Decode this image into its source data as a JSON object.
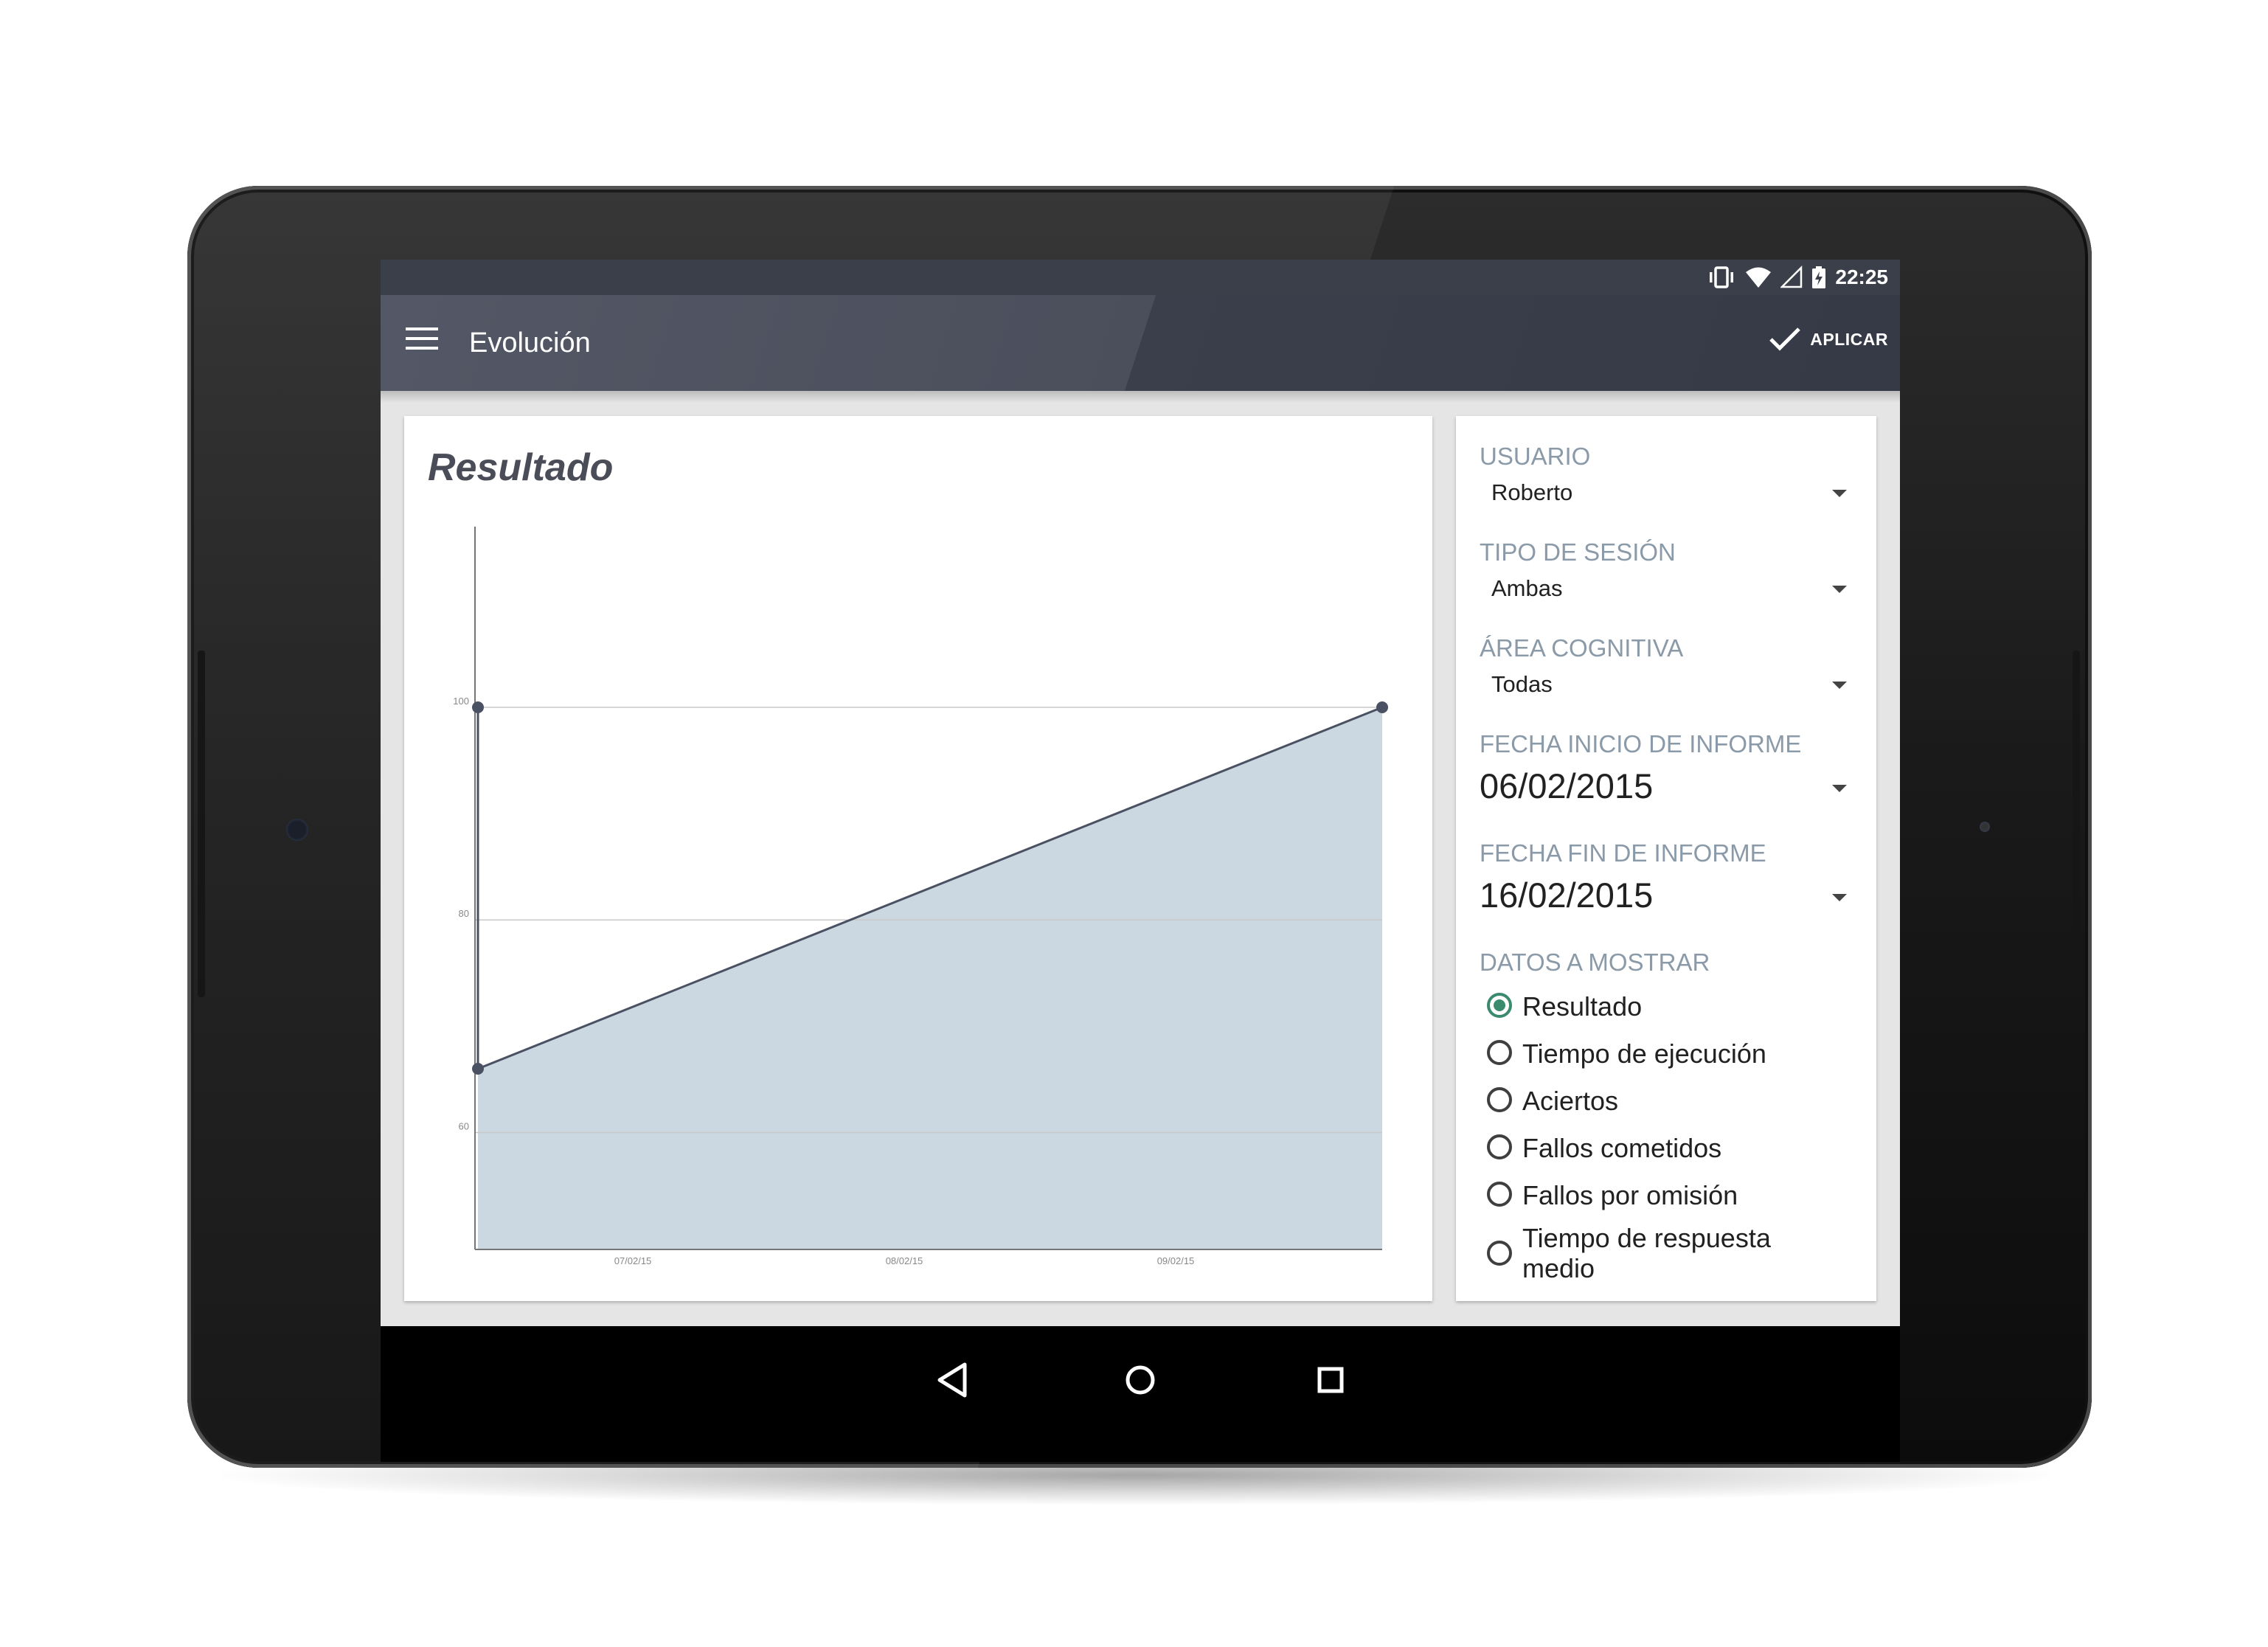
{
  "status_bar": {
    "time": "22:25",
    "icons": [
      "vibrate-icon",
      "wifi-icon",
      "cell-signal-icon",
      "battery-charging-icon"
    ]
  },
  "app_bar": {
    "title": "Evolución",
    "menu_icon": "hamburger-menu-icon",
    "apply_icon": "check-icon",
    "apply_label": "APLICAR"
  },
  "chart": {
    "title": "Resultado"
  },
  "chart_data": {
    "type": "area",
    "title": "Resultado",
    "xlabel": "",
    "ylabel": "",
    "x_tick_labels": [
      "07/02/15",
      "08/02/15",
      "09/02/15"
    ],
    "y_tick_labels": [
      "60",
      "80",
      "100"
    ],
    "ylim": [
      49,
      117
    ],
    "grid": true,
    "series": [
      {
        "x": [
          "06/02/15",
          "06/02/15",
          "09/02/15 +"
        ],
        "values": [
          100,
          66,
          100
        ]
      }
    ],
    "colors": {
      "line": "#4a5162",
      "fill": "#cbd8e1",
      "grid": "#c8c8c8",
      "axis": "#757575"
    }
  },
  "filters": {
    "usuario": {
      "label": "USUARIO",
      "value": "Roberto"
    },
    "tipo_sesion": {
      "label": "TIPO DE SESIÓN",
      "value": "Ambas"
    },
    "area_cognitiva": {
      "label": "ÁREA COGNITIVA",
      "value": "Todas"
    },
    "fecha_inicio": {
      "label": "FECHA INICIO DE INFORME",
      "value": "06/02/2015"
    },
    "fecha_fin": {
      "label": "FECHA FIN DE INFORME",
      "value": "16/02/2015"
    },
    "datos": {
      "label": "DATOS A MOSTRAR",
      "selected": "Resultado",
      "options": [
        "Resultado",
        "Tiempo de ejecución",
        "Aciertos",
        "Fallos cometidos",
        "Fallos por omisión",
        "Tiempo de respuesta medio"
      ]
    }
  },
  "nav_bar": {
    "buttons": [
      "back-icon",
      "home-icon",
      "recents-icon"
    ]
  },
  "colors": {
    "accent": "#3a8a6e",
    "label": "#8a9aa8",
    "app_bar": "#4b4f5c"
  }
}
